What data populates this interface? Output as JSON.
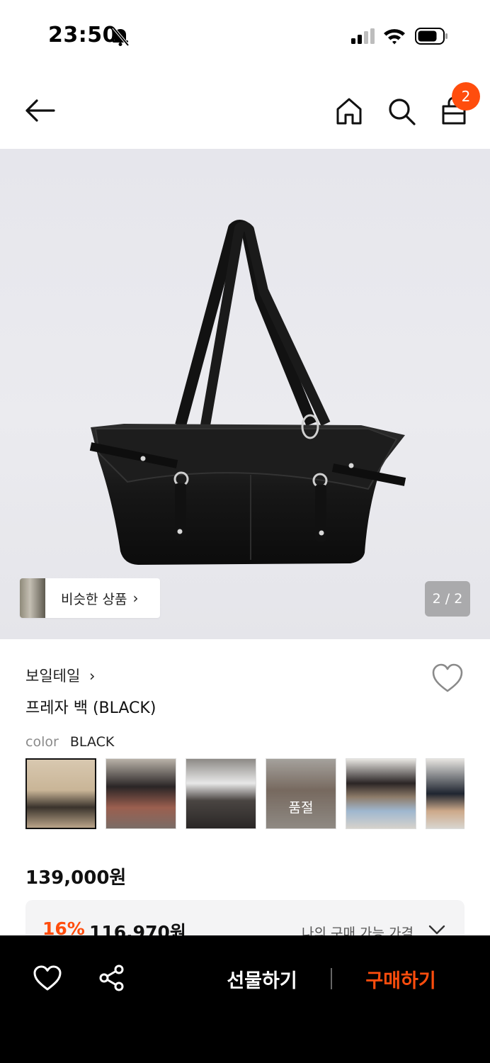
{
  "status_bar": {
    "time": "23:50",
    "icons": [
      "bell-off-icon",
      "signal-icon",
      "wifi-icon",
      "battery-icon"
    ]
  },
  "top_nav": {
    "icons": [
      "back-arrow-icon",
      "home-icon",
      "search-icon",
      "shopping-bag-icon"
    ],
    "cart_count": "2",
    "accent_color": "#ff4d0d"
  },
  "product_image": {
    "similar_products_label": "비슷한 상품",
    "similar_products_chevron": "›",
    "page_indicator": "2 / 2"
  },
  "product_info": {
    "brand": "보일테일",
    "brand_chevron": "›",
    "title": "프레자 백 (BLACK)",
    "color_label": "color",
    "color_value": "BLACK",
    "sold_out_label": "품절"
  },
  "pricing": {
    "original_price": "139,000원",
    "discount_rate": "16%",
    "discounted_price": "116,970원",
    "my_price_label": "나의 구매 가능 가격"
  },
  "bottom_bar": {
    "gift_label": "선물하기",
    "buy_label": "구매하기",
    "icons": [
      "heart-icon",
      "share-icon"
    ]
  }
}
